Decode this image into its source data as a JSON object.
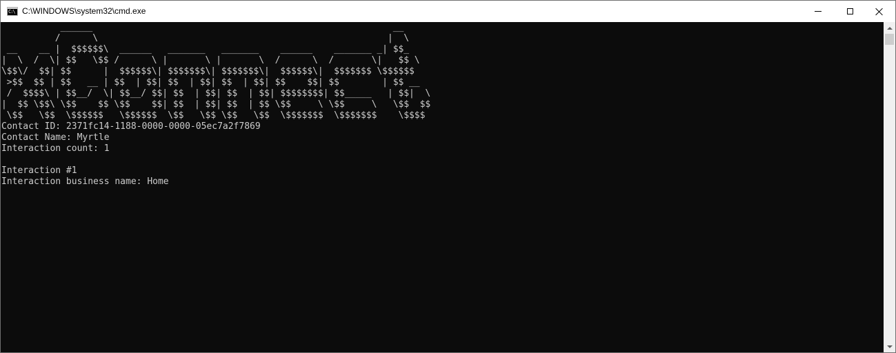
{
  "window": {
    "title": "C:\\WINDOWS\\system32\\cmd.exe",
    "app_icon": "console-icon",
    "app_icon_text": "C:\\"
  },
  "caption_buttons": {
    "minimize": "minimize-icon",
    "maximize": "maximize-icon",
    "close": "close-icon"
  },
  "console": {
    "ascii_art": "           ______                                                        __\n          /      \\                                                      |  \\\n __    __ |  $$$$$$\\  ______   _______   _______    ______    _______ _| $$_\n|  \\  /  \\| $$   \\$$ /      \\ |       \\ |       \\  /      \\  /       \\|   $$ \\\n\\$$\\/  $$| $$      |  $$$$$$\\| $$$$$$$\\| $$$$$$$\\|  $$$$$$\\|  $$$$$$$ \\$$$$$$\n >$$  $$ | $$   __ | $$  | $$| $$  | $$| $$  | $$| $$    $$| $$        | $$ __\n /  $$$$\\ | $$__/  \\| $$__/ $$| $$  | $$| $$  | $$| $$$$$$$$| $$_____   | $$|  \\\n|  $$ \\$$\\ \\$$    $$ \\$$    $$| $$  | $$| $$  | $$ \\$$     \\ \\$$     \\   \\$$  $$\n \\$$   \\$$  \\$$$$$$   \\$$$$$$  \\$$   \\$$ \\$$   \\$$  \\$$$$$$$  \\$$$$$$$    \\$$$$",
    "lines": [
      "Contact ID: 2371fc14-1188-0000-0000-05ec7a2f7869",
      "Contact Name: Myrtle",
      "Interaction count: 1",
      "",
      "Interaction #1",
      "Interaction business name: Home"
    ]
  },
  "colors": {
    "console_background": "#0c0c0c",
    "console_text": "#cccccc",
    "titlebar_background": "#ffffff",
    "scrollbar_track": "#f0f0f0",
    "scrollbar_thumb": "#cdcdcd"
  },
  "scrollbar": {
    "up_icon": "scroll-up-arrow-icon",
    "down_icon": "scroll-down-arrow-icon"
  }
}
